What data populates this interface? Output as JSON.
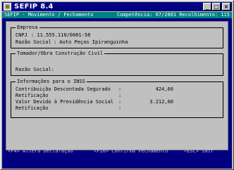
{
  "window": {
    "title": "SEFIP 8.4",
    "buttons": {
      "minimize": "_",
      "maximize": "□",
      "close": "×"
    }
  },
  "statusbar": {
    "left": "SEFIP - Movimento / Fechamento",
    "right": "Competência: 07/2001   Recolhimento: 115"
  },
  "empresa": {
    "title": "Empresa",
    "cnpj_label": "CNPJ",
    "cnpj_value": ": 11.555.110/0001-58",
    "razao_label": "Razão Social",
    "razao_value": ": Auto Peças Ipiranguinha"
  },
  "tomador": {
    "title": "Tomador/Obra Construção Civil",
    "razao_label": "Razão Social:"
  },
  "informacoes": {
    "title": "Informações para o INSS",
    "rows": [
      {
        "label": "Contribuição Descontada Segurado",
        "sep": ":",
        "value": "424,60"
      },
      {
        "label": "Retificação",
        "sep": ":",
        "value": ""
      },
      {
        "label": "Valor Devido à Previdência Social",
        "sep": ":",
        "value": "3.212,60"
      },
      {
        "label": "Retificação",
        "sep": ":",
        "value": ""
      }
    ]
  },
  "fkeys": {
    "f4": "<F4> Altera Declaração",
    "f10": "<F10> Confirma Fechamento",
    "esc": "<ESC> Sair"
  }
}
